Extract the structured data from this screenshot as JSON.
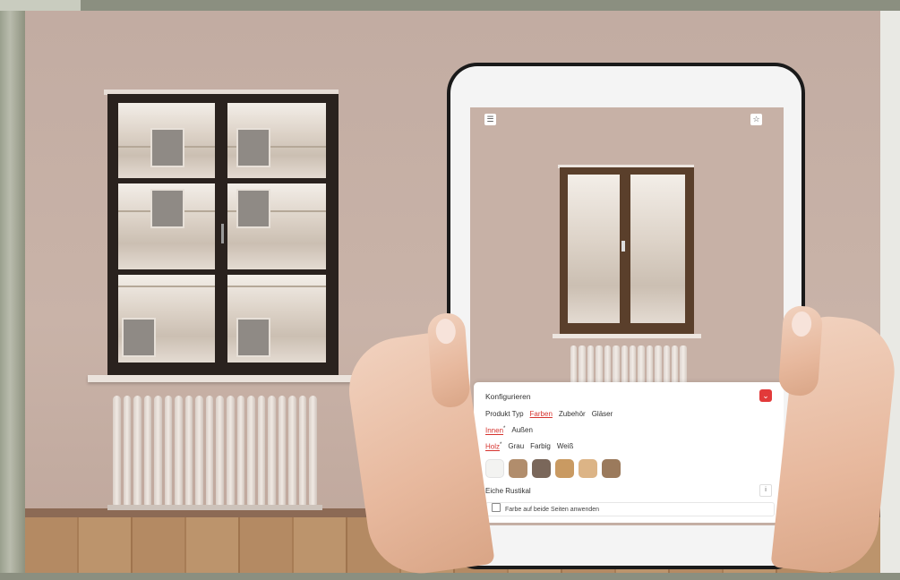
{
  "scene": {
    "wall_color": "#c6b0a5",
    "window_frame_color": "#2a221e"
  },
  "tablet": {
    "toolbar": {
      "menu_icon": "menu-icon",
      "favorite_icon": "star-icon"
    },
    "configurator": {
      "title": "Konfigurieren",
      "close_icon": "chevron-down-icon",
      "accent_color": "#e23a3a",
      "main_tabs": [
        {
          "label": "Produkt Typ",
          "active": false
        },
        {
          "label": "Farben",
          "active": true
        },
        {
          "label": "Zubehör",
          "active": false
        },
        {
          "label": "Gläser",
          "active": false
        }
      ],
      "side_tabs": [
        {
          "label": "Innen",
          "marker": "*",
          "active": true
        },
        {
          "label": "Außen",
          "active": false
        }
      ],
      "color_groups": [
        {
          "label": "Holz",
          "marker": "*",
          "active": true
        },
        {
          "label": "Grau",
          "active": false
        },
        {
          "label": "Farbig",
          "active": false
        },
        {
          "label": "Weiß",
          "active": false
        }
      ],
      "swatches": [
        "#f3f3f1",
        "#b18d6c",
        "#7a675a",
        "#c99a62",
        "#dcb486",
        "#9b7a5c"
      ],
      "selected_color_name": "Eiche Rustikal",
      "info_icon": "info-icon",
      "apply_both_sides_label": "Farbe auf beide Seiten anwenden"
    }
  }
}
